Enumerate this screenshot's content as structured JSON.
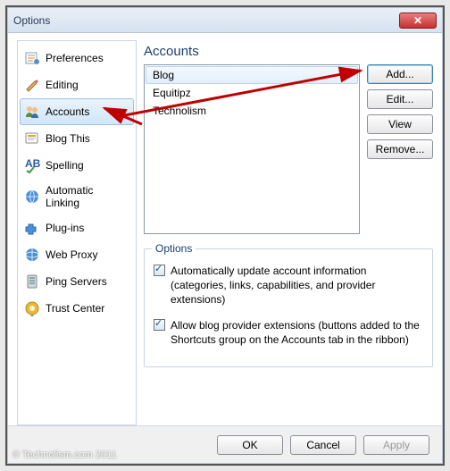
{
  "window": {
    "title": "Options"
  },
  "sidebar": {
    "items": [
      {
        "label": "Preferences",
        "icon": "preferences-icon"
      },
      {
        "label": "Editing",
        "icon": "editing-icon"
      },
      {
        "label": "Accounts",
        "icon": "accounts-icon",
        "selected": true
      },
      {
        "label": "Blog This",
        "icon": "blog-this-icon"
      },
      {
        "label": "Spelling",
        "icon": "spelling-icon"
      },
      {
        "label": "Automatic Linking",
        "icon": "auto-linking-icon"
      },
      {
        "label": "Plug-ins",
        "icon": "plugins-icon"
      },
      {
        "label": "Web Proxy",
        "icon": "web-proxy-icon"
      },
      {
        "label": "Ping Servers",
        "icon": "ping-servers-icon"
      },
      {
        "label": "Trust Center",
        "icon": "trust-center-icon"
      }
    ]
  },
  "main": {
    "heading": "Accounts",
    "accounts": [
      {
        "name": "Blog",
        "selected": true
      },
      {
        "name": "Equitipz"
      },
      {
        "name": "Technolism"
      }
    ],
    "buttons": {
      "add": "Add...",
      "edit": "Edit...",
      "view": "View",
      "remove": "Remove..."
    },
    "options_group": {
      "legend": "Options",
      "auto_update": "Automatically update account information (categories, links, capabilities, and provider extensions)",
      "allow_ext": "Allow blog provider extensions (buttons added to the Shortcuts group on the Accounts tab in the ribbon)"
    }
  },
  "footer": {
    "ok": "OK",
    "cancel": "Cancel",
    "apply": "Apply"
  },
  "watermark": "© Technolism.com 2011"
}
